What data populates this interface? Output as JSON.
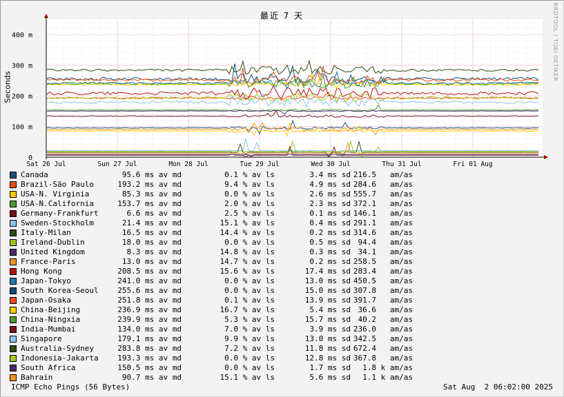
{
  "watermark": "RRDTOOL / TOBI OETIKER",
  "footer": {
    "left": "ICMP Echo Pings (56 Bytes)",
    "right": "Sat Aug  2 06:02:00 2025"
  },
  "chart_data": {
    "type": "line",
    "title": "最近 7 天",
    "xlabel": "",
    "ylabel": "Seconds",
    "ylim": [
      0,
      0.45
    ],
    "yticks": [
      {
        "v": 0,
        "label": "0"
      },
      {
        "v": 0.1,
        "label": "100 m"
      },
      {
        "v": 0.2,
        "label": "200 m"
      },
      {
        "v": 0.3,
        "label": "300 m"
      },
      {
        "v": 0.4,
        "label": "400 m"
      }
    ],
    "xticks": [
      "Sat 26 Jul",
      "Sun 27 Jul",
      "Mon 28 Jul",
      "Tue 29 Jul",
      "Wed 30 Jul",
      "Thu 31 Jul",
      "Fri 01 Aug"
    ],
    "grid": true,
    "series": [
      {
        "name": "Canada",
        "color": "#1c4f7f",
        "avg": "95.6 ms av md",
        "loss": "0.1 % av ls",
        "sd": "3.4 ms sd",
        "ams": "216.5   am/as"
      },
      {
        "name": "Brazil-São Paulo",
        "color": "#f0491c",
        "avg": "193.2 ms av md",
        "loss": "9.4 % av ls",
        "sd": "4.9 ms sd",
        "ams": "284.6   am/as"
      },
      {
        "name": "USA-N. Virginia",
        "color": "#ffcc00",
        "avg": "85.3 ms av md",
        "loss": "0.0 % av ls",
        "sd": "2.6 ms sd",
        "ams": "555.7   am/as"
      },
      {
        "name": "USA-N.California",
        "color": "#4b9a2c",
        "avg": "153.7 ms av md",
        "loss": "2.0 % av ls",
        "sd": "2.3 ms sd",
        "ams": "372.1   am/as"
      },
      {
        "name": "Germany-Frankfurt",
        "color": "#750e1f",
        "avg": "6.6 ms av md",
        "loss": "2.5 % av ls",
        "sd": "0.1 ms sd",
        "ams": "146.1   am/as"
      },
      {
        "name": "Sweden-Stockholm",
        "color": "#85c7f2",
        "avg": "21.4 ms av md",
        "loss": "15.1 % av ls",
        "sd": "0.4 ms sd",
        "ams": "291.1   am/as"
      },
      {
        "name": "Italy-Milan",
        "color": "#334d10",
        "avg": "16.5 ms av md",
        "loss": "14.4 % av ls",
        "sd": "0.2 ms sd",
        "ams": "314.6   am/as"
      },
      {
        "name": "Ireland-Dublin",
        "color": "#a2c51f",
        "avg": "18.0 ms av md",
        "loss": "0.0 % av ls",
        "sd": "0.5 ms sd",
        "ams": "94.4   am/as"
      },
      {
        "name": "United Kingdom",
        "color": "#4d2c6e",
        "avg": "8.3 ms av md",
        "loss": "14.8 % av ls",
        "sd": "0.3 ms sd",
        "ams": "34.1   am/as"
      },
      {
        "name": "France-Paris",
        "color": "#f59422",
        "avg": "13.0 ms av md",
        "loss": "14.7 % av ls",
        "sd": "0.2 ms sd",
        "ams": "258.5   am/as"
      },
      {
        "name": "Hong Kong",
        "color": "#b40f0f",
        "avg": "208.5 ms av md",
        "loss": "15.6 % av ls",
        "sd": "17.4 ms sd",
        "ams": "283.4   am/as"
      },
      {
        "name": "Japan-Tokyo",
        "color": "#1f78b4",
        "avg": "241.0 ms av md",
        "loss": "0.0 % av ls",
        "sd": "13.0 ms sd",
        "ams": "450.5   am/as"
      },
      {
        "name": "South Korea-Seoul",
        "color": "#0f4f7a",
        "avg": "255.6 ms av md",
        "loss": "0.0 % av ls",
        "sd": "15.0 ms sd",
        "ams": "307.8   am/as"
      },
      {
        "name": "Japan-Osaka",
        "color": "#ef4a1a",
        "avg": "251.8 ms av md",
        "loss": "0.1 % av ls",
        "sd": "13.9 ms sd",
        "ams": "391.7   am/as"
      },
      {
        "name": "China-Beijing",
        "color": "#ffd200",
        "avg": "236.9 ms av md",
        "loss": "16.7 % av ls",
        "sd": "5.4 ms sd",
        "ams": "36.6   am/as"
      },
      {
        "name": "China-Ningxia",
        "color": "#4a9b2f",
        "avg": "239.9 ms av md",
        "loss": "5.3 % av ls",
        "sd": "15.7 ms sd",
        "ams": "40.2   am/as"
      },
      {
        "name": "India-Mumbai",
        "color": "#7a0f23",
        "avg": "134.0 ms av md",
        "loss": "7.0 % av ls",
        "sd": "3.9 ms sd",
        "ams": "236.0   am/as"
      },
      {
        "name": "Singapore",
        "color": "#8cc8f5",
        "avg": "179.1 ms av md",
        "loss": "9.9 % av ls",
        "sd": "13.0 ms sd",
        "ams": "342.5   am/as"
      },
      {
        "name": "Australia-Sydney",
        "color": "#2f4a10",
        "avg": "283.8 ms av md",
        "loss": "7.2 % av ls",
        "sd": "11.8 ms sd",
        "ams": "672.4   am/as"
      },
      {
        "name": "Indonesia-Jakarta",
        "color": "#a4c823",
        "avg": "193.3 ms av md",
        "loss": "0.0 % av ls",
        "sd": "12.8 ms sd",
        "ams": "367.8   am/as"
      },
      {
        "name": "South Africa",
        "color": "#4b2d6f",
        "avg": "150.5 ms av md",
        "loss": "0.0 % av ls",
        "sd": "1.7 ms sd",
        "ams": "1.8 k am/as"
      },
      {
        "name": "Bahrain",
        "color": "#f7941d",
        "avg": "90.7 ms av md",
        "loss": "15.1 % av ls",
        "sd": "5.6 ms sd",
        "ams": "1.1 k am/as"
      }
    ]
  }
}
